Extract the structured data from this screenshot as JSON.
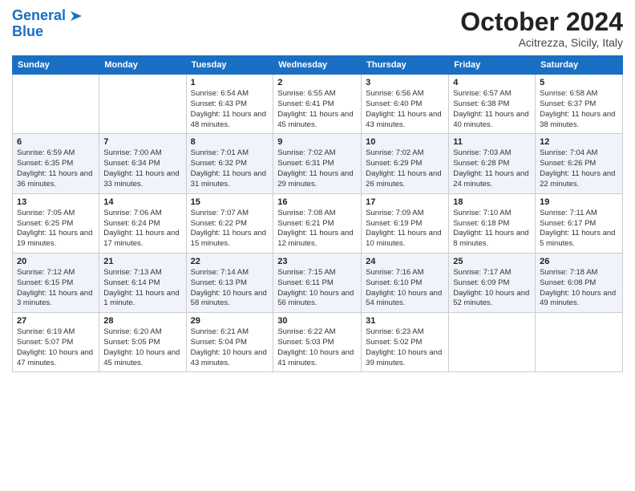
{
  "logo": {
    "line1": "General",
    "line2": "Blue",
    "icon": "▶"
  },
  "header": {
    "month": "October 2024",
    "location": "Acitrezza, Sicily, Italy"
  },
  "weekdays": [
    "Sunday",
    "Monday",
    "Tuesday",
    "Wednesday",
    "Thursday",
    "Friday",
    "Saturday"
  ],
  "weeks": [
    [
      {
        "day": "",
        "info": ""
      },
      {
        "day": "",
        "info": ""
      },
      {
        "day": "1",
        "info": "Sunrise: 6:54 AM\nSunset: 6:43 PM\nDaylight: 11 hours and 48 minutes."
      },
      {
        "day": "2",
        "info": "Sunrise: 6:55 AM\nSunset: 6:41 PM\nDaylight: 11 hours and 45 minutes."
      },
      {
        "day": "3",
        "info": "Sunrise: 6:56 AM\nSunset: 6:40 PM\nDaylight: 11 hours and 43 minutes."
      },
      {
        "day": "4",
        "info": "Sunrise: 6:57 AM\nSunset: 6:38 PM\nDaylight: 11 hours and 40 minutes."
      },
      {
        "day": "5",
        "info": "Sunrise: 6:58 AM\nSunset: 6:37 PM\nDaylight: 11 hours and 38 minutes."
      }
    ],
    [
      {
        "day": "6",
        "info": "Sunrise: 6:59 AM\nSunset: 6:35 PM\nDaylight: 11 hours and 36 minutes."
      },
      {
        "day": "7",
        "info": "Sunrise: 7:00 AM\nSunset: 6:34 PM\nDaylight: 11 hours and 33 minutes."
      },
      {
        "day": "8",
        "info": "Sunrise: 7:01 AM\nSunset: 6:32 PM\nDaylight: 11 hours and 31 minutes."
      },
      {
        "day": "9",
        "info": "Sunrise: 7:02 AM\nSunset: 6:31 PM\nDaylight: 11 hours and 29 minutes."
      },
      {
        "day": "10",
        "info": "Sunrise: 7:02 AM\nSunset: 6:29 PM\nDaylight: 11 hours and 26 minutes."
      },
      {
        "day": "11",
        "info": "Sunrise: 7:03 AM\nSunset: 6:28 PM\nDaylight: 11 hours and 24 minutes."
      },
      {
        "day": "12",
        "info": "Sunrise: 7:04 AM\nSunset: 6:26 PM\nDaylight: 11 hours and 22 minutes."
      }
    ],
    [
      {
        "day": "13",
        "info": "Sunrise: 7:05 AM\nSunset: 6:25 PM\nDaylight: 11 hours and 19 minutes."
      },
      {
        "day": "14",
        "info": "Sunrise: 7:06 AM\nSunset: 6:24 PM\nDaylight: 11 hours and 17 minutes."
      },
      {
        "day": "15",
        "info": "Sunrise: 7:07 AM\nSunset: 6:22 PM\nDaylight: 11 hours and 15 minutes."
      },
      {
        "day": "16",
        "info": "Sunrise: 7:08 AM\nSunset: 6:21 PM\nDaylight: 11 hours and 12 minutes."
      },
      {
        "day": "17",
        "info": "Sunrise: 7:09 AM\nSunset: 6:19 PM\nDaylight: 11 hours and 10 minutes."
      },
      {
        "day": "18",
        "info": "Sunrise: 7:10 AM\nSunset: 6:18 PM\nDaylight: 11 hours and 8 minutes."
      },
      {
        "day": "19",
        "info": "Sunrise: 7:11 AM\nSunset: 6:17 PM\nDaylight: 11 hours and 5 minutes."
      }
    ],
    [
      {
        "day": "20",
        "info": "Sunrise: 7:12 AM\nSunset: 6:15 PM\nDaylight: 11 hours and 3 minutes."
      },
      {
        "day": "21",
        "info": "Sunrise: 7:13 AM\nSunset: 6:14 PM\nDaylight: 11 hours and 1 minute."
      },
      {
        "day": "22",
        "info": "Sunrise: 7:14 AM\nSunset: 6:13 PM\nDaylight: 10 hours and 58 minutes."
      },
      {
        "day": "23",
        "info": "Sunrise: 7:15 AM\nSunset: 6:11 PM\nDaylight: 10 hours and 56 minutes."
      },
      {
        "day": "24",
        "info": "Sunrise: 7:16 AM\nSunset: 6:10 PM\nDaylight: 10 hours and 54 minutes."
      },
      {
        "day": "25",
        "info": "Sunrise: 7:17 AM\nSunset: 6:09 PM\nDaylight: 10 hours and 52 minutes."
      },
      {
        "day": "26",
        "info": "Sunrise: 7:18 AM\nSunset: 6:08 PM\nDaylight: 10 hours and 49 minutes."
      }
    ],
    [
      {
        "day": "27",
        "info": "Sunrise: 6:19 AM\nSunset: 5:07 PM\nDaylight: 10 hours and 47 minutes."
      },
      {
        "day": "28",
        "info": "Sunrise: 6:20 AM\nSunset: 5:05 PM\nDaylight: 10 hours and 45 minutes."
      },
      {
        "day": "29",
        "info": "Sunrise: 6:21 AM\nSunset: 5:04 PM\nDaylight: 10 hours and 43 minutes."
      },
      {
        "day": "30",
        "info": "Sunrise: 6:22 AM\nSunset: 5:03 PM\nDaylight: 10 hours and 41 minutes."
      },
      {
        "day": "31",
        "info": "Sunrise: 6:23 AM\nSunset: 5:02 PM\nDaylight: 10 hours and 39 minutes."
      },
      {
        "day": "",
        "info": ""
      },
      {
        "day": "",
        "info": ""
      }
    ]
  ]
}
